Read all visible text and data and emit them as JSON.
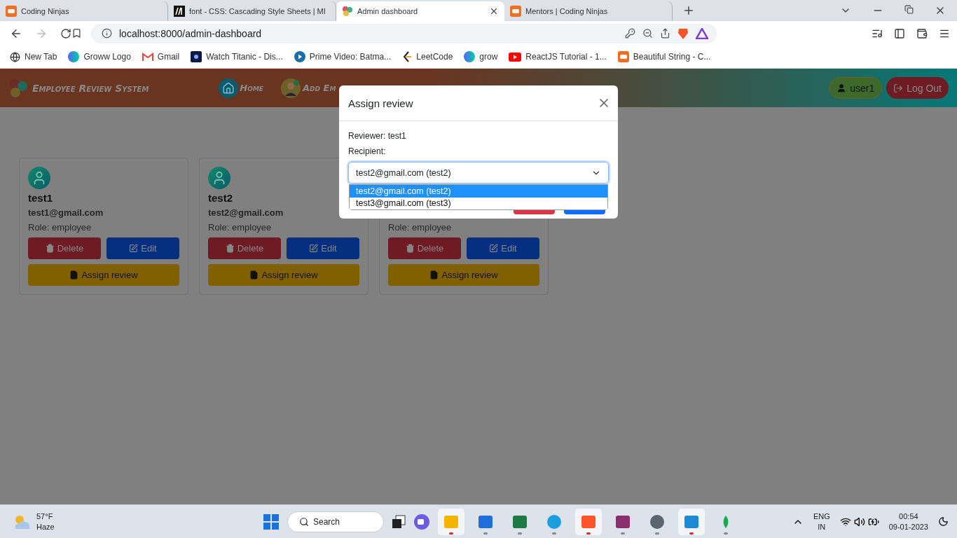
{
  "browser": {
    "tabs": [
      {
        "title": "Coding Ninjas",
        "selected": false,
        "kind": "ninja"
      },
      {
        "title": "font - CSS: Cascading Style Sheets | MI",
        "selected": false,
        "kind": "mdn"
      },
      {
        "title": "Admin dashboard",
        "selected": true,
        "kind": "faces"
      },
      {
        "title": "Mentors | Coding Ninjas",
        "selected": false,
        "kind": "ninja"
      }
    ],
    "url": "localhost:8000/admin-dashboard",
    "bookmarks": [
      {
        "label": "New Tab",
        "kind": "globe"
      },
      {
        "label": "Groww Logo",
        "kind": "groww"
      },
      {
        "label": "Gmail",
        "kind": "gmail"
      },
      {
        "label": "Watch Titanic - Dis...",
        "kind": "hotstar"
      },
      {
        "label": "Prime Video: Batma...",
        "kind": "prime"
      },
      {
        "label": "LeetCode",
        "kind": "leetcode"
      },
      {
        "label": "grow",
        "kind": "groww"
      },
      {
        "label": "ReactJS Tutorial - 1...",
        "kind": "youtube"
      },
      {
        "label": "Beautiful String - C...",
        "kind": "ninja"
      }
    ]
  },
  "navbar": {
    "brand": "Employee Review System",
    "links": [
      {
        "label": "Home",
        "kind": "home"
      },
      {
        "label": "Add Em",
        "kind": "person"
      }
    ],
    "user": "user1",
    "logout": "Log Out"
  },
  "cards": [
    {
      "name": "test1",
      "email": "test1@gmail.com",
      "role": "Role: employee",
      "delete": "Delete",
      "edit": "Edit",
      "assign": "Assign review"
    },
    {
      "name": "test2",
      "email": "test2@gmail.com",
      "role": "Role: employee",
      "delete": "Delete",
      "edit": "Edit",
      "assign": "Assign review"
    },
    {
      "role": "Role: employee",
      "delete": "Delete",
      "edit": "Edit",
      "assign": "Assign review"
    }
  ],
  "modal": {
    "title": "Assign review",
    "reviewer": "Reviewer: test1",
    "recipient_label": "Recipient:",
    "value": "test2@gmail.com (test2)",
    "options": [
      {
        "label": "test2@gmail.com (test2)",
        "selected": true
      },
      {
        "label": "test3@gmail.com (test3)",
        "selected": false
      }
    ]
  },
  "taskbar": {
    "temperature": "57°F",
    "condition": "Haze",
    "search": "Search",
    "lang": "ENG",
    "region": "IN",
    "time": "00:54",
    "date": "09-01-2023",
    "apps": [
      {
        "kind": "files",
        "active": true
      },
      {
        "kind": "store",
        "active": false
      },
      {
        "kind": "excel",
        "active": false
      },
      {
        "kind": "edge",
        "active": false
      },
      {
        "kind": "brave",
        "active": true
      },
      {
        "kind": "winrar",
        "active": false
      },
      {
        "kind": "settings",
        "active": false
      },
      {
        "kind": "vscode",
        "active": true
      },
      {
        "kind": "mongo",
        "active": false
      }
    ]
  }
}
